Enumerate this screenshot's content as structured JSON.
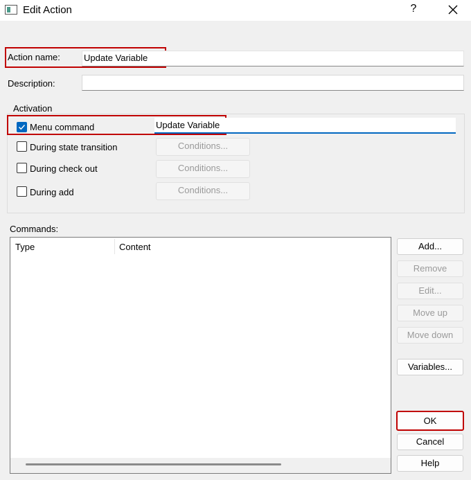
{
  "window": {
    "title": "Edit Action",
    "help_label": "?",
    "close_label": "✕"
  },
  "form": {
    "action_name_label": "Action name:",
    "action_name_value": "Update Variable",
    "description_label": "Description:",
    "description_value": ""
  },
  "activation": {
    "group_label": "Activation",
    "menu_command_label": "Menu command",
    "menu_command_checked": true,
    "menu_command_value": "Update Variable",
    "state_transition_label": "During state transition",
    "check_out_label": "During check out",
    "add_label": "During add",
    "conditions_label": "Conditions..."
  },
  "commands": {
    "label": "Commands:",
    "columns": [
      "Type",
      "Content"
    ],
    "rows": []
  },
  "side_buttons": {
    "add": "Add...",
    "remove": "Remove",
    "edit": "Edit...",
    "move_up": "Move up",
    "move_down": "Move down",
    "variables": "Variables..."
  },
  "dialog_buttons": {
    "ok": "OK",
    "cancel": "Cancel",
    "help": "Help"
  },
  "colors": {
    "highlight": "#c00000",
    "accent": "#0067c0"
  }
}
